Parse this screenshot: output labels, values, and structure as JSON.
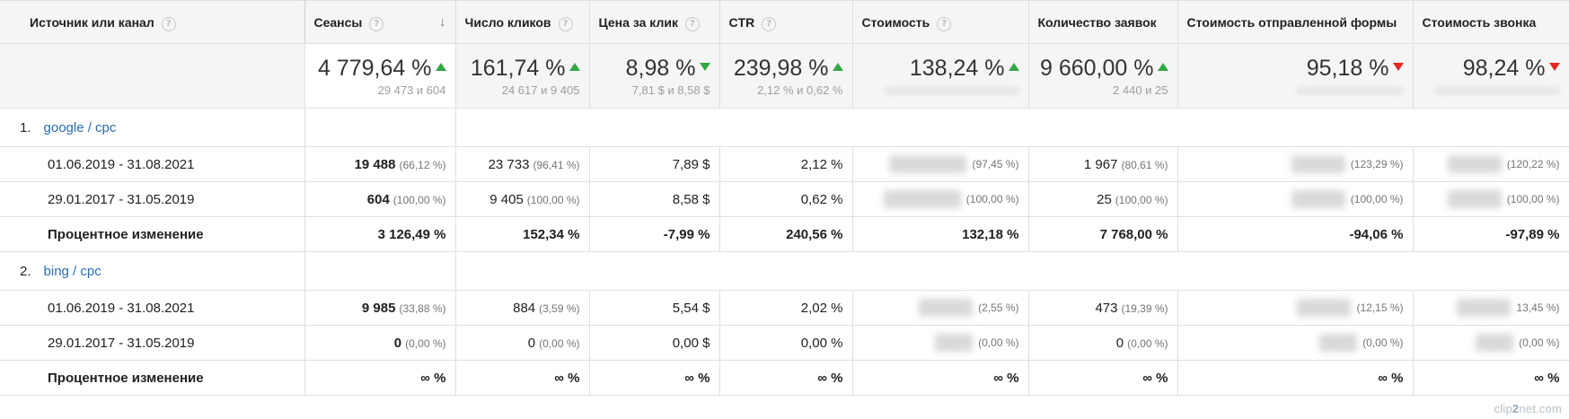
{
  "columns": [
    {
      "label": "Источник или канал",
      "help": true
    },
    {
      "label": "Сеансы",
      "help": true,
      "sort": true
    },
    {
      "label": "Число кликов",
      "help": true
    },
    {
      "label": "Цена за клик",
      "help": true
    },
    {
      "label": "CTR",
      "help": true
    },
    {
      "label": "Стоимость",
      "help": true
    },
    {
      "label": "Количество заявок",
      "help": false
    },
    {
      "label": "Стоимость отправленной формы",
      "help": false
    },
    {
      "label": "Стоимость звонка",
      "help": false
    }
  ],
  "sort_icon": "↓",
  "help_icon": "?",
  "totals": [
    {
      "value": "4 779,64 %",
      "trend": "up",
      "sub": "29 473 и 604"
    },
    {
      "value": "161,74 %",
      "trend": "up",
      "sub": "24 617 и 9 405"
    },
    {
      "value": "8,98 %",
      "trend": "down-green",
      "sub": "7,81 $ и 8,58 $"
    },
    {
      "value": "239,98 %",
      "trend": "up",
      "sub": "2,12 % и 0,62 %"
    },
    {
      "value": "138,24 %",
      "trend": "up",
      "sub": ""
    },
    {
      "value": "9 660,00 %",
      "trend": "up",
      "sub": "2 440 и 25"
    },
    {
      "value": "95,18 %",
      "trend": "down",
      "sub": ""
    },
    {
      "value": "98,24 %",
      "trend": "down",
      "sub": ""
    }
  ],
  "colors": {
    "trend_up": "#31a842",
    "trend_down": "#e8261f",
    "link": "#2a6cb0"
  },
  "groups": [
    {
      "num": "1.",
      "name": "google / cpc",
      "rows": [
        {
          "label": "01.06.2019 - 31.08.2021",
          "cells": [
            {
              "v": "19 488",
              "p": "(66,12 %)",
              "bold": true
            },
            {
              "v": "23 733",
              "p": "(96,41 %)"
            },
            {
              "v": "7,89 $"
            },
            {
              "v": "2,12 %"
            },
            {
              "p": "(97,45 %)",
              "blur": "lg"
            },
            {
              "v": "1 967",
              "p": "(80,61 %)"
            },
            {
              "p": "(123,29 %)",
              "blur": "md"
            },
            {
              "p": "(120,22 %)",
              "blur": "md"
            }
          ]
        },
        {
          "label": "29.01.2017 - 31.05.2019",
          "cells": [
            {
              "v": "604",
              "p": "(100,00 %)",
              "bold": true
            },
            {
              "v": "9 405",
              "p": "(100,00 %)"
            },
            {
              "v": "8,58 $"
            },
            {
              "v": "0,62 %"
            },
            {
              "p": "(100,00 %)",
              "blur": "lg"
            },
            {
              "v": "25",
              "p": "(100,00 %)"
            },
            {
              "p": "(100,00 %)",
              "blur": "md"
            },
            {
              "p": "(100,00 %)",
              "blur": "md"
            }
          ]
        },
        {
          "label": "Процентное изменение",
          "pct": true,
          "cells": [
            {
              "v": "3 126,49 %"
            },
            {
              "v": "152,34 %"
            },
            {
              "v": "-7,99 %"
            },
            {
              "v": "240,56 %"
            },
            {
              "v": "132,18 %"
            },
            {
              "v": "7 768,00 %"
            },
            {
              "v": "-94,06 %"
            },
            {
              "v": "-97,89 %"
            }
          ]
        }
      ]
    },
    {
      "num": "2.",
      "name": "bing / cpc",
      "rows": [
        {
          "label": "01.06.2019 - 31.08.2021",
          "cells": [
            {
              "v": "9 985",
              "p": "(33,88 %)",
              "bold": true
            },
            {
              "v": "884",
              "p": "(3,59 %)"
            },
            {
              "v": "5,54 $"
            },
            {
              "v": "2,02 %"
            },
            {
              "p": "(2,55 %)",
              "blur": "md"
            },
            {
              "v": "473",
              "p": "(19,39 %)"
            },
            {
              "p": "(12,15 %)",
              "blur": "md"
            },
            {
              "p": "13,45 %)",
              "blur": "md"
            }
          ]
        },
        {
          "label": "29.01.2017 - 31.05.2019",
          "cells": [
            {
              "v": "0",
              "p": "(0,00 %)",
              "bold": true
            },
            {
              "v": "0",
              "p": "(0,00 %)"
            },
            {
              "v": "0,00 $"
            },
            {
              "v": "0,00 %"
            },
            {
              "p": "(0,00 %)",
              "blur": "sm"
            },
            {
              "v": "0",
              "p": "(0,00 %)"
            },
            {
              "p": "(0,00 %)",
              "blur": "sm"
            },
            {
              "p": "(0,00 %)",
              "blur": "sm"
            }
          ]
        },
        {
          "label": "Процентное изменение",
          "pct": true,
          "cells": [
            {
              "v": "∞ %"
            },
            {
              "v": "∞ %"
            },
            {
              "v": "∞ %"
            },
            {
              "v": "∞ %"
            },
            {
              "v": "∞ %"
            },
            {
              "v": "∞ %"
            },
            {
              "v": "∞ %"
            },
            {
              "v": "∞ %"
            }
          ]
        }
      ]
    }
  ],
  "watermark": {
    "pre": "clip",
    "mid": "2",
    "post": "net.com"
  }
}
